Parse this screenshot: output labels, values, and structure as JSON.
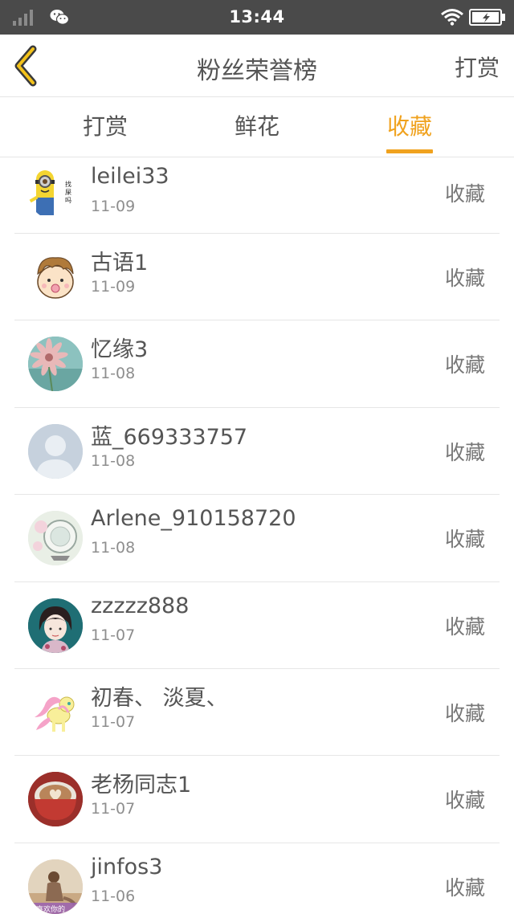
{
  "status_bar": {
    "time": "13:44"
  },
  "header": {
    "title": "粉丝荣誉榜",
    "right_action": "打赏"
  },
  "tabs": [
    {
      "label": "打赏",
      "active": false
    },
    {
      "label": "鲜花",
      "active": false
    },
    {
      "label": "收藏",
      "active": true
    }
  ],
  "colors": {
    "accent": "#f0a21e",
    "status_bar": "#4a4a4a",
    "divider": "#e6e6e6"
  },
  "list": [
    {
      "name": "leilei33",
      "date": "11-09",
      "action": "收藏",
      "avatar": "minion-avatar-icon",
      "avatar_text": "找屎吗"
    },
    {
      "name": "古语1",
      "date": "11-09",
      "action": "收藏",
      "avatar": "cartoon-kid-avatar-icon"
    },
    {
      "name": "忆缘3",
      "date": "11-08",
      "action": "收藏",
      "avatar": "flower-avatar-icon"
    },
    {
      "name": "蓝_669333757",
      "date": "11-08",
      "action": "收藏",
      "avatar": "default-person-avatar-icon"
    },
    {
      "name": "Arlene_910158720",
      "date": "11-08",
      "action": "收藏",
      "avatar": "glass-sphere-avatar-icon"
    },
    {
      "name": "zzzzz888",
      "date": "11-07",
      "action": "收藏",
      "avatar": "anime-girl-avatar-icon"
    },
    {
      "name": "初春、 淡夏、",
      "date": "11-07",
      "action": "收藏",
      "avatar": "pony-avatar-icon"
    },
    {
      "name": "老杨同志1",
      "date": "11-07",
      "action": "收藏",
      "avatar": "coffee-cup-avatar-icon"
    },
    {
      "name": "jinfos3",
      "date": "11-06",
      "action": "收藏",
      "avatar": "beach-girl-avatar-icon",
      "avatar_text": "喜欢你的"
    }
  ]
}
